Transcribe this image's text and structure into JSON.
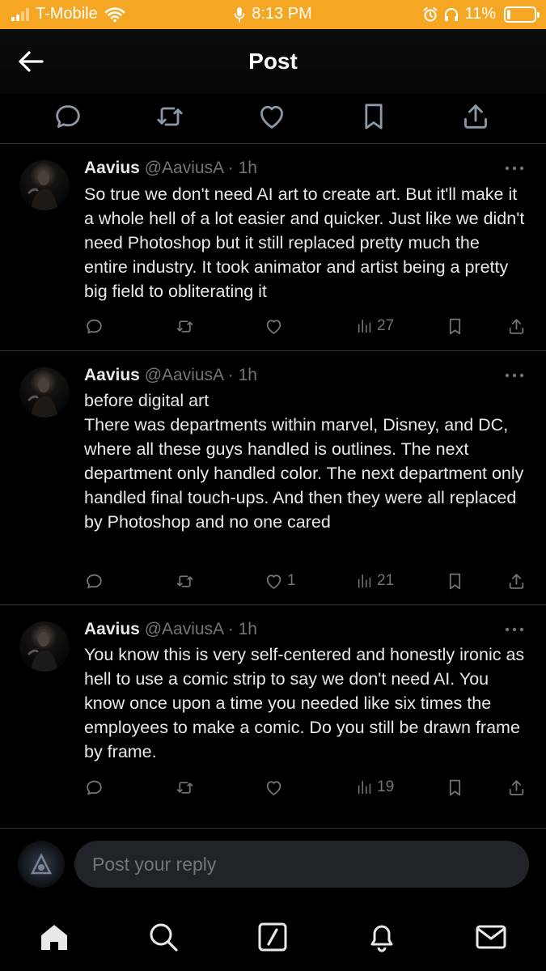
{
  "status_bar": {
    "carrier": "T-Mobile",
    "time": "8:13 PM",
    "battery": "11%",
    "battery_level": 0.11
  },
  "header": {
    "title": "Post"
  },
  "replies": [
    {
      "name": "Aavius",
      "handle": "@AaviusA",
      "separator": "·",
      "time": "1h",
      "text": "So true we don't need AI art to create art. But it'll make it a whole hell of a lot easier and quicker. Just like we didn't need Photoshop but it still replaced pretty much the entire industry. It took animator and artist being a pretty big field to obliterating it",
      "likes": "",
      "views": "27"
    },
    {
      "name": "Aavius",
      "handle": "@AaviusA",
      "separator": "·",
      "time": "1h",
      "text": "before digital art\nThere was departments within marvel, Disney, and DC, where all these guys handled is outlines. The next department only handled color. The next department only handled final touch-ups. And then they were all replaced by Photoshop and no one cared",
      "likes": "1",
      "views": "21"
    },
    {
      "name": "Aavius",
      "handle": "@AaviusA",
      "separator": "·",
      "time": "1h",
      "text": "You know this is very self-centered and honestly ironic as hell to use a comic strip to say we don't need AI. You know once upon a time you needed like six times the employees to make a comic. Do you still be drawn frame by frame.",
      "likes": "",
      "views": "19"
    }
  ],
  "composer": {
    "placeholder": "Post your reply"
  },
  "icons": {
    "nav": [
      "home-icon",
      "search-icon",
      "grok-icon",
      "notifications-icon",
      "messages-icon"
    ],
    "actions": [
      "reply-icon",
      "repost-icon",
      "like-icon",
      "views-icon",
      "bookmark-icon",
      "share-icon"
    ]
  },
  "colors": {
    "status_bar": "#f5a623",
    "text": "#e7e9ea",
    "muted": "#71767b",
    "divider": "#2f3336"
  }
}
